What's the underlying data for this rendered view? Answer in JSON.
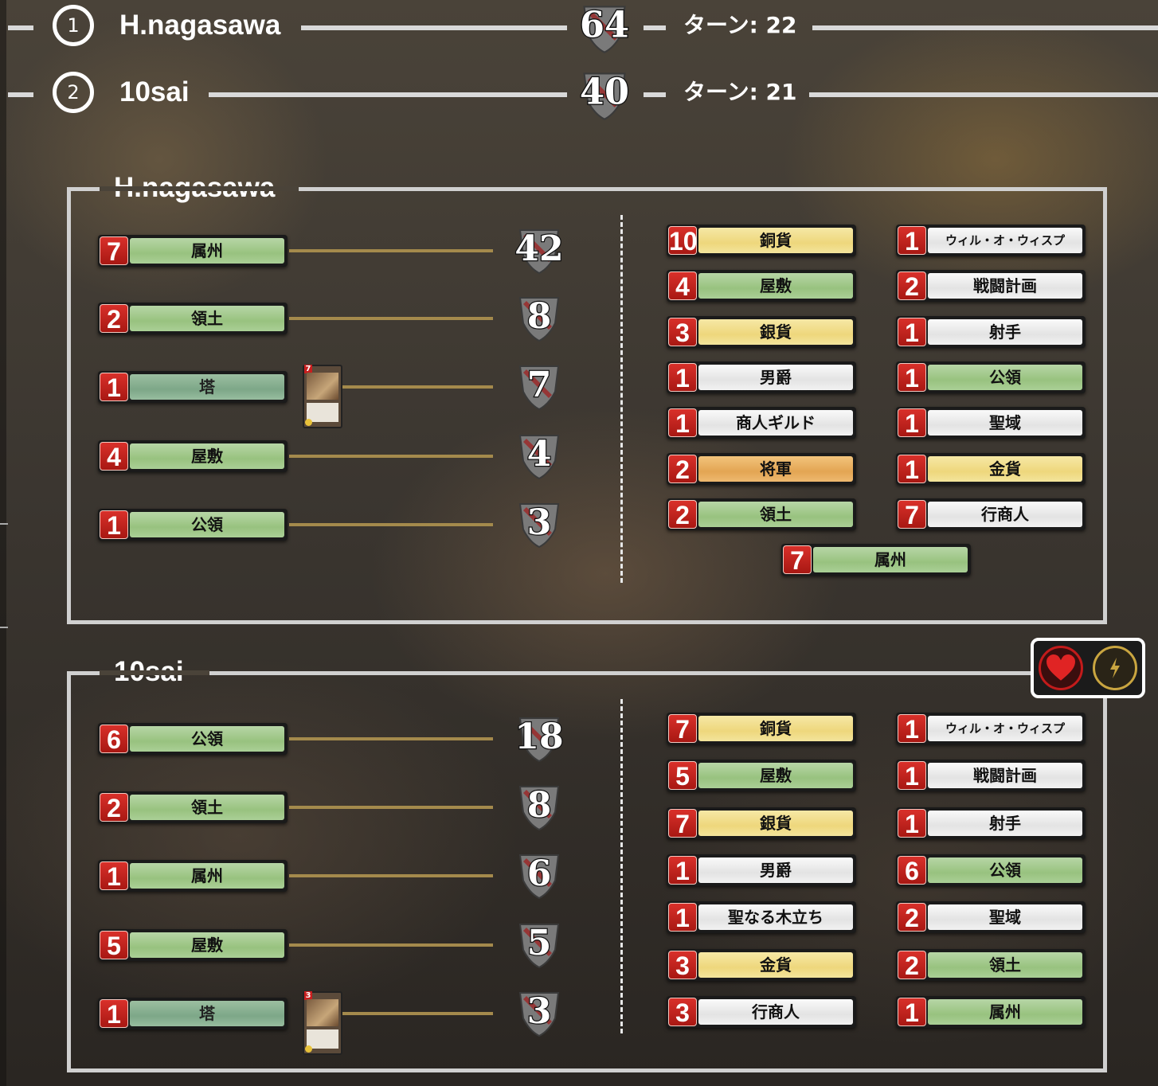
{
  "scoreboard": [
    {
      "rank": "1",
      "name": "H.nagasawa",
      "vp": "64",
      "turn": "ターン: 22"
    },
    {
      "rank": "2",
      "name": "10sai",
      "vp": "40",
      "turn": "ターン: 21"
    }
  ],
  "players": [
    {
      "name": "H.nagasawa",
      "vp_rows": [
        {
          "count": "7",
          "card": "属州",
          "points": "42",
          "color": "green"
        },
        {
          "count": "2",
          "card": "領土",
          "points": "8",
          "color": "green"
        },
        {
          "count": "1",
          "card": "塔",
          "points": "7",
          "color": "blurred",
          "mini_card": true,
          "mini_cost": "7"
        },
        {
          "count": "4",
          "card": "屋敷",
          "points": "4",
          "color": "green"
        },
        {
          "count": "1",
          "card": "公領",
          "points": "3",
          "color": "green"
        }
      ],
      "deck_left": [
        {
          "count": "10",
          "card": "銅貨",
          "color": "yellow"
        },
        {
          "count": "4",
          "card": "屋敷",
          "color": "green"
        },
        {
          "count": "3",
          "card": "銀貨",
          "color": "yellow"
        },
        {
          "count": "1",
          "card": "男爵",
          "color": "white"
        },
        {
          "count": "1",
          "card": "商人ギルド",
          "color": "white"
        },
        {
          "count": "2",
          "card": "将軍",
          "color": "orange"
        },
        {
          "count": "2",
          "card": "領土",
          "color": "green"
        }
      ],
      "deck_right": [
        {
          "count": "1",
          "card": "ウィル・オ・ウィスプ",
          "color": "white"
        },
        {
          "count": "2",
          "card": "戦闘計画",
          "color": "white"
        },
        {
          "count": "1",
          "card": "射手",
          "color": "white"
        },
        {
          "count": "1",
          "card": "公領",
          "color": "green"
        },
        {
          "count": "1",
          "card": "聖域",
          "color": "white"
        },
        {
          "count": "1",
          "card": "金貨",
          "color": "yellow"
        },
        {
          "count": "7",
          "card": "行商人",
          "color": "white"
        }
      ],
      "deck_extra": [
        {
          "count": "7",
          "card": "属州",
          "color": "green"
        }
      ]
    },
    {
      "name": "10sai",
      "vp_rows": [
        {
          "count": "6",
          "card": "公領",
          "points": "18",
          "color": "green"
        },
        {
          "count": "2",
          "card": "領土",
          "points": "8",
          "color": "green"
        },
        {
          "count": "1",
          "card": "属州",
          "points": "6",
          "color": "green"
        },
        {
          "count": "5",
          "card": "屋敷",
          "points": "5",
          "color": "green"
        },
        {
          "count": "1",
          "card": "塔",
          "points": "3",
          "color": "blurred",
          "mini_card": true,
          "mini_cost": "3"
        }
      ],
      "deck_left": [
        {
          "count": "7",
          "card": "銅貨",
          "color": "yellow"
        },
        {
          "count": "5",
          "card": "屋敷",
          "color": "green"
        },
        {
          "count": "7",
          "card": "銀貨",
          "color": "yellow"
        },
        {
          "count": "1",
          "card": "男爵",
          "color": "white"
        },
        {
          "count": "1",
          "card": "聖なる木立ち",
          "color": "white"
        },
        {
          "count": "3",
          "card": "金貨",
          "color": "yellow"
        },
        {
          "count": "3",
          "card": "行商人",
          "color": "white"
        }
      ],
      "deck_right": [
        {
          "count": "1",
          "card": "ウィル・オ・ウィスプ",
          "color": "white"
        },
        {
          "count": "1",
          "card": "戦闘計画",
          "color": "white"
        },
        {
          "count": "1",
          "card": "射手",
          "color": "white"
        },
        {
          "count": "6",
          "card": "公領",
          "color": "green"
        },
        {
          "count": "2",
          "card": "聖域",
          "color": "white"
        },
        {
          "count": "2",
          "card": "領土",
          "color": "green"
        },
        {
          "count": "1",
          "card": "属州",
          "color": "green"
        }
      ],
      "deck_extra": []
    }
  ],
  "icons": {
    "like": "heart-icon",
    "quick": "lightning-icon"
  },
  "colors": {
    "accent_red": "#c21b1b",
    "connector": "#a48a4c",
    "gold": "#c9a540"
  }
}
